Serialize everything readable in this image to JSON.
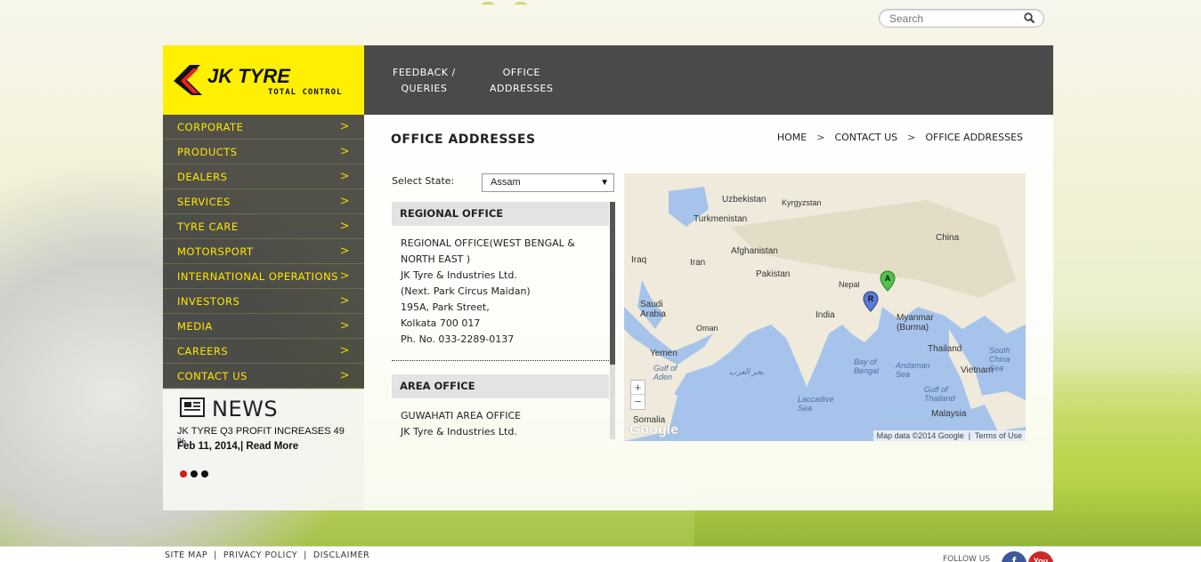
{
  "search": {
    "placeholder": "Search"
  },
  "brand": {
    "name": "JK TYRE",
    "tagline": "TOTAL CONTROL"
  },
  "topnav": [
    {
      "line1": "FEEDBACK /",
      "line2": "QUERIES"
    },
    {
      "line1": "OFFICE",
      "line2": "ADDRESSES"
    }
  ],
  "sidebar": {
    "items": [
      {
        "label": "CORPORATE"
      },
      {
        "label": "PRODUCTS"
      },
      {
        "label": "DEALERS"
      },
      {
        "label": "SERVICES"
      },
      {
        "label": "TYRE CARE"
      },
      {
        "label": "MOTORSPORT"
      },
      {
        "label": "INTERNATIONAL OPERATIONS"
      },
      {
        "label": "INVESTORS"
      },
      {
        "label": "MEDIA"
      },
      {
        "label": "CAREERS"
      },
      {
        "label": "CONTACT US"
      }
    ]
  },
  "news": {
    "title": "NEWS",
    "headline": "JK TYRE Q3 PROFIT INCREASES 49 %",
    "date": "Feb 11, 2014,|",
    "read_more": "Read More"
  },
  "page": {
    "title": "OFFICE ADDRESSES",
    "breadcrumb": [
      "HOME",
      "CONTACT US",
      "OFFICE ADDRESSES"
    ],
    "state_label": "Select State:",
    "state_value": "Assam"
  },
  "offices": [
    {
      "heading": "REGIONAL OFFICE",
      "lines": [
        "REGIONAL OFFICE(WEST BENGAL &",
        "NORTH EAST )",
        "JK Tyre & Industries Ltd.",
        "(Next. Park Circus Maidan)",
        "195A, Park Street,",
        "Kolkata 700 017",
        "Ph. No. 033-2289-0137"
      ]
    },
    {
      "heading": "AREA OFFICE",
      "lines": [
        "GUWAHATI AREA OFFICE",
        "JK Tyre & Industries Ltd."
      ]
    }
  ],
  "map": {
    "labels": [
      "Uzbekistan",
      "Kyrgyzstan",
      "Turkmenistan",
      "China",
      "Iraq",
      "Iran",
      "Afghanistan",
      "Pakistan",
      "Nepal",
      "Saudi Arabia",
      "India",
      "Myanmar (Burma)",
      "Oman",
      "Yemen",
      "Thailand",
      "Vietnam",
      "Malaysia",
      "Somalia"
    ],
    "seas": [
      "Gulf of Aden",
      "بحر العرب",
      "Bay of Bengal",
      "Andaman Sea",
      "Laccadive Sea",
      "Gulf of Thailand",
      "South China Sea"
    ],
    "markers": [
      "A",
      "R"
    ],
    "zoom_in": "+",
    "zoom_out": "−",
    "logo": "Google",
    "attribution": "Map data ©2014 Google",
    "terms": "Terms of Use",
    "colors": {
      "land": "#efeadb",
      "water": "#a6c4eb",
      "marker_a": "#4fc34a",
      "marker_r": "#5b7bd5"
    }
  },
  "footer": {
    "links": [
      "SITE MAP",
      "PRIVACY POLICY",
      "DISCLAIMER"
    ],
    "follow": "FOLLOW US",
    "social": [
      {
        "icon": "facebook-icon",
        "glyph": "f",
        "color": "#3b5998"
      },
      {
        "icon": "youtube-icon",
        "glyph": "You",
        "color": "#cc2a2a"
      }
    ]
  },
  "colors": {
    "brand_yellow": "#ffef00",
    "nav_dark": "#4a4a4a",
    "sidebar_text": "#ffe600"
  }
}
